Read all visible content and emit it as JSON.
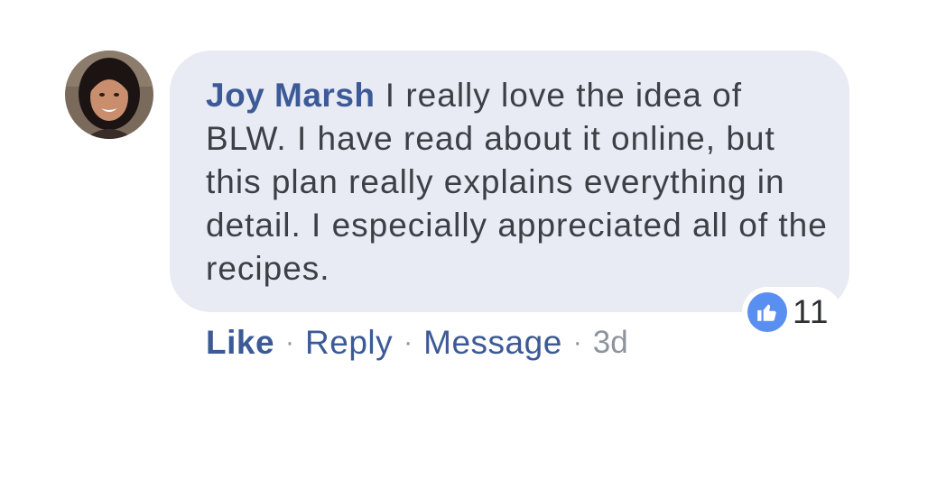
{
  "comment": {
    "author": "Joy Marsh",
    "text": "I really love the idea of BLW. I have read about it online, but this plan really explains everything in detail. I especially appreciated all of the recipes.",
    "avatar_icon": "user-avatar-photo"
  },
  "reactions": {
    "icon": "thumbs-up-icon",
    "count": "11",
    "color": "#5a8ff2"
  },
  "actions": {
    "like_label": "Like",
    "reply_label": "Reply",
    "message_label": "Message",
    "separator": "·",
    "timestamp": "3d"
  },
  "colors": {
    "bubble": "#e8eaf4",
    "link": "#3c5a96",
    "muted": "#8d949e"
  }
}
